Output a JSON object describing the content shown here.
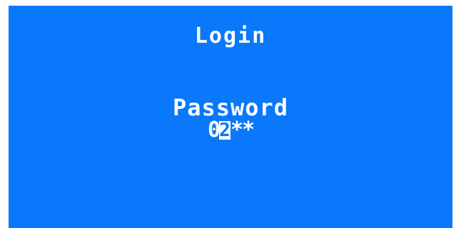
{
  "screen": {
    "title": "Login",
    "field_label": "Password",
    "password": {
      "entered": "0",
      "cursor_char": "2",
      "masked": [
        "*",
        "*"
      ]
    }
  },
  "colors": {
    "background": "#0a78fb",
    "text": "#ffffff"
  }
}
